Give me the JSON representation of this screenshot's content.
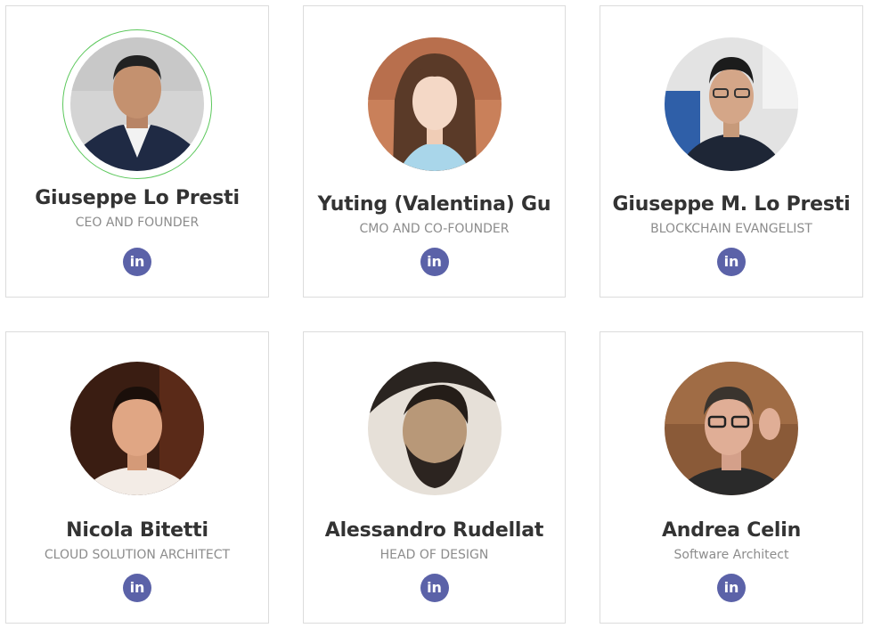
{
  "team": [
    {
      "name": "Giuseppe Lo Presti",
      "role": "CEO AND FOUNDER",
      "social_icon": "linkedin-icon",
      "social_glyph": "in"
    },
    {
      "name": "Yuting (Valentina) Gu",
      "role": "CMO AND CO-FOUNDER",
      "social_icon": "linkedin-icon",
      "social_glyph": "in"
    },
    {
      "name": "Giuseppe M. Lo Presti",
      "role": "BLOCKCHAIN EVANGELIST",
      "social_icon": "linkedin-icon",
      "social_glyph": "in"
    },
    {
      "name": "Nicola Bitetti",
      "role": "CLOUD SOLUTION ARCHITECT",
      "social_icon": "linkedin-icon",
      "social_glyph": "in"
    },
    {
      "name": "Alessandro Rudellat",
      "role": "HEAD OF DESIGN",
      "social_icon": "linkedin-icon",
      "social_glyph": "in"
    },
    {
      "name": "Andrea Celin",
      "role": "Software Architect",
      "social_icon": "linkedin-icon",
      "social_glyph": "in"
    }
  ],
  "colors": {
    "card_border": "#dcdcdc",
    "name_text": "#333333",
    "role_text": "#8c8c8c",
    "linkedin_button": "#5b62a8",
    "hover_ring": "#5cc85c"
  }
}
